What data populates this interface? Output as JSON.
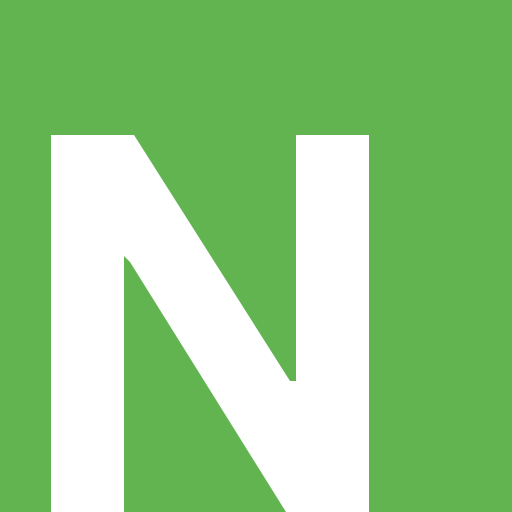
{
  "logo": {
    "letter": "N",
    "background_color": "#62B451",
    "glyph_color": "#FFFFFF"
  }
}
